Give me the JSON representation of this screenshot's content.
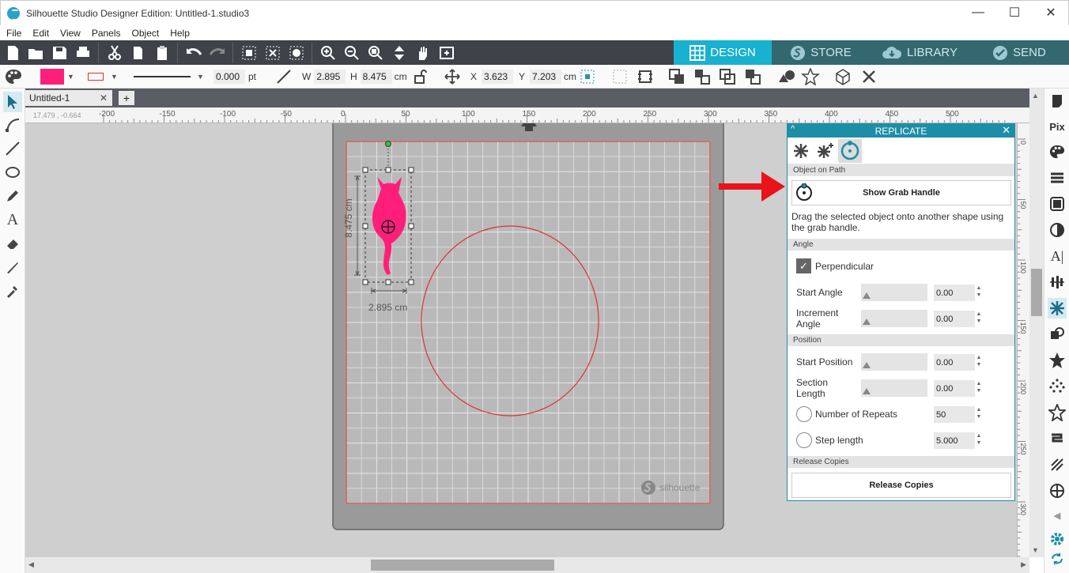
{
  "window": {
    "title": "Silhouette Studio Designer Edition: Untitled-1.studio3",
    "minimize": "—",
    "maximize": "☐",
    "close": "✕"
  },
  "menu": [
    "File",
    "Edit",
    "View",
    "Panels",
    "Object",
    "Help"
  ],
  "main_tabs": [
    {
      "label": "DESIGN",
      "active": true
    },
    {
      "label": "STORE",
      "active": false
    },
    {
      "label": "LIBRARY",
      "active": false
    },
    {
      "label": "SEND",
      "active": false
    }
  ],
  "toolbar2": {
    "fill_color": "#ff1f7a",
    "line_color": "#e03030",
    "line_width": "0.000",
    "line_unit": "pt",
    "w_label": "W",
    "w_value": "2.895",
    "h_label": "H",
    "h_value": "8.475",
    "size_unit": "cm",
    "x_label": "X",
    "x_value": "3.623",
    "y_label": "Y",
    "y_value": "7.203",
    "pos_unit": "cm"
  },
  "doc_tab": {
    "label": "Untitled-1",
    "close": "✕",
    "add": "+"
  },
  "ruler": {
    "coords": "17.479 , -0.664",
    "h_ticks": [
      "-200",
      "-150",
      "-100",
      "-50",
      "0",
      "50",
      "100",
      "150",
      "200",
      "250",
      "300",
      "350",
      "400",
      "450",
      "500"
    ],
    "v_ticks": [
      "0",
      "50",
      "100",
      "150",
      "200",
      "250",
      "300"
    ]
  },
  "canvas": {
    "height_dim": "8.475 cm",
    "width_dim": "2.895 cm",
    "watermark": "silhouette",
    "shape_color": "#ff1f7a",
    "circle_color": "#e03030"
  },
  "panel": {
    "title": "REPLICATE",
    "min_icon": "^",
    "close_icon": "✕",
    "section_object_on_path": "Object on Path",
    "show_grab_handle": "Show Grab Handle",
    "description": "Drag the selected object onto another shape using the grab handle.",
    "section_angle": "Angle",
    "perpendicular_label": "Perpendicular",
    "perpendicular_checked": true,
    "start_angle_label": "Start Angle",
    "start_angle_value": "0.00",
    "increment_angle_label": "Increment Angle",
    "increment_angle_value": "0.00",
    "section_position": "Position",
    "start_position_label": "Start Position",
    "start_position_value": "0.00",
    "section_length_label": "Section Length",
    "section_length_value": "0.00",
    "number_of_repeats_label": "Number of Repeats",
    "number_of_repeats_value": "50",
    "step_length_label": "Step length",
    "step_length_value": "5.000",
    "section_release": "Release Copies",
    "release_copies_button": "Release Copies"
  },
  "right_tools": {
    "pix_label": "Pix",
    "text_label": "A|"
  },
  "colors": {
    "accent": "#18b1d0",
    "toolbar": "#3f4248",
    "arrow": "#e8141a"
  }
}
